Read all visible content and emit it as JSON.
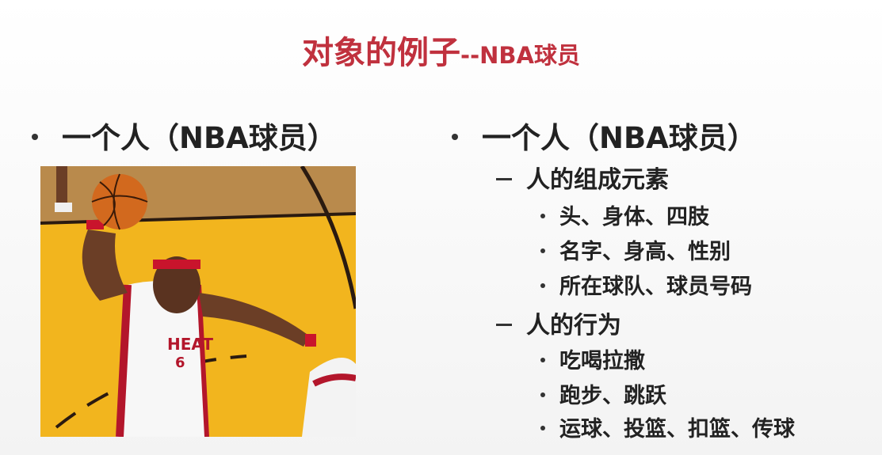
{
  "title": {
    "main": "对象的例子",
    "suffix": "--NBA球员"
  },
  "left": {
    "bullet": "一个人（NBA球员）"
  },
  "right": {
    "bullet": "一个人（NBA球员）",
    "sections": [
      {
        "heading": "人的组成元素",
        "items": [
          "头、身体、四肢",
          "名字、身高、性别",
          "所在球队、球员号码"
        ]
      },
      {
        "heading": "人的行为",
        "items": [
          "吃喝拉撒",
          "跑步、跳跃",
          "运球、投篮、扣篮、传球"
        ]
      }
    ]
  },
  "image": {
    "jersey_text": "HEAT",
    "jersey_number": "6"
  },
  "colors": {
    "title": "#c0313e",
    "court_yellow": "#f2b51e",
    "jersey_red": "#b3162b"
  }
}
